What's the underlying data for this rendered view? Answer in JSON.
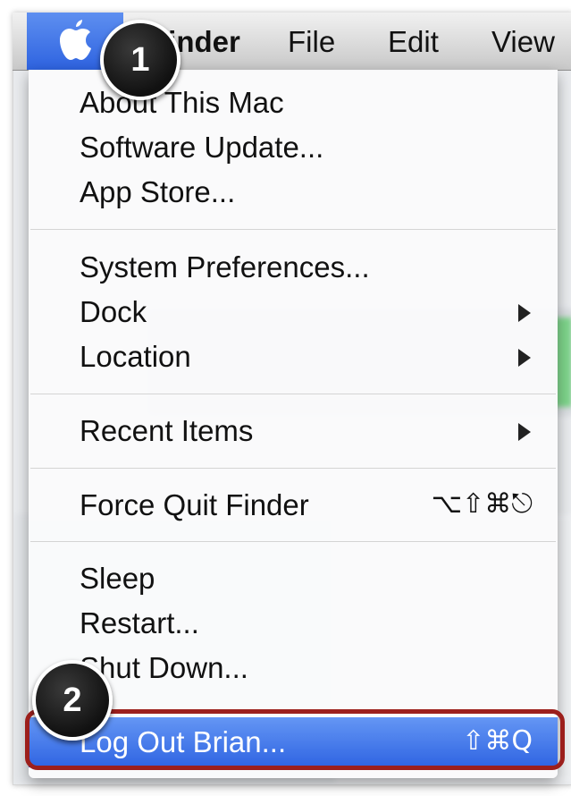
{
  "menubar": {
    "apple_icon": "apple-icon",
    "items": [
      "Finder",
      "File",
      "Edit",
      "View"
    ]
  },
  "menu": {
    "items": [
      {
        "label": "About This Mac"
      },
      {
        "label": "Software Update..."
      },
      {
        "label": "App Store..."
      },
      {
        "label": "System Preferences..."
      },
      {
        "label": "Dock",
        "submenu": true
      },
      {
        "label": "Location",
        "submenu": true
      },
      {
        "label": "Recent Items",
        "submenu": true
      },
      {
        "label": "Force Quit Finder",
        "shortcut": "⌥⇧⌘⎋"
      },
      {
        "label": "Sleep"
      },
      {
        "label": "Restart..."
      },
      {
        "label": "Shut Down..."
      },
      {
        "label": "Log Out Brian...",
        "shortcut": "⇧⌘Q",
        "highlighted": true
      }
    ]
  },
  "badges": {
    "step1": "1",
    "step2": "2"
  },
  "colors": {
    "highlight": "#3a6fe6",
    "annotation_outline": "#9c1f1c",
    "badge": "#111111"
  }
}
